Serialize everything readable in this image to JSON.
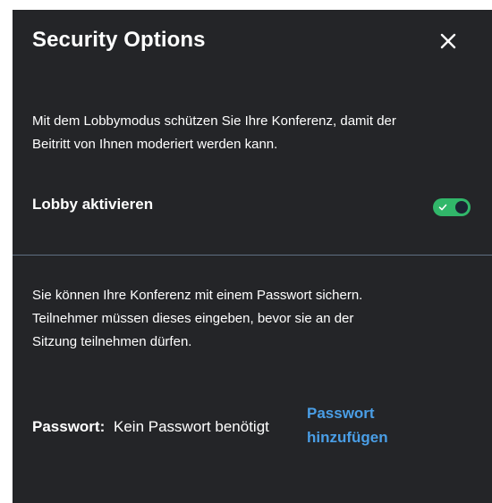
{
  "dialog": {
    "title": "Security Options",
    "close_icon": "close-icon"
  },
  "lobby": {
    "description_line1": "Mit dem Lobbymodus schützen Sie Ihre Konferenz, damit der",
    "description_line2": "Beitritt von Ihnen moderiert werden kann.",
    "toggle_label": "Lobby aktivieren",
    "toggle_on": true,
    "toggle_color": "#31b76a"
  },
  "password": {
    "description_line1": "Sie können Ihre Konferenz mit einem Passwort sichern.",
    "description_line2": "Teilnehmer müssen dieses eingeben, bevor sie an der",
    "description_line3": "Sitzung teilnehmen dürfen.",
    "label": "Passwort:",
    "value": "Kein Passwort benötigt",
    "add_link_line1": "Passwort",
    "add_link_line2": "hinzufügen",
    "link_color": "#4a9ee6"
  }
}
